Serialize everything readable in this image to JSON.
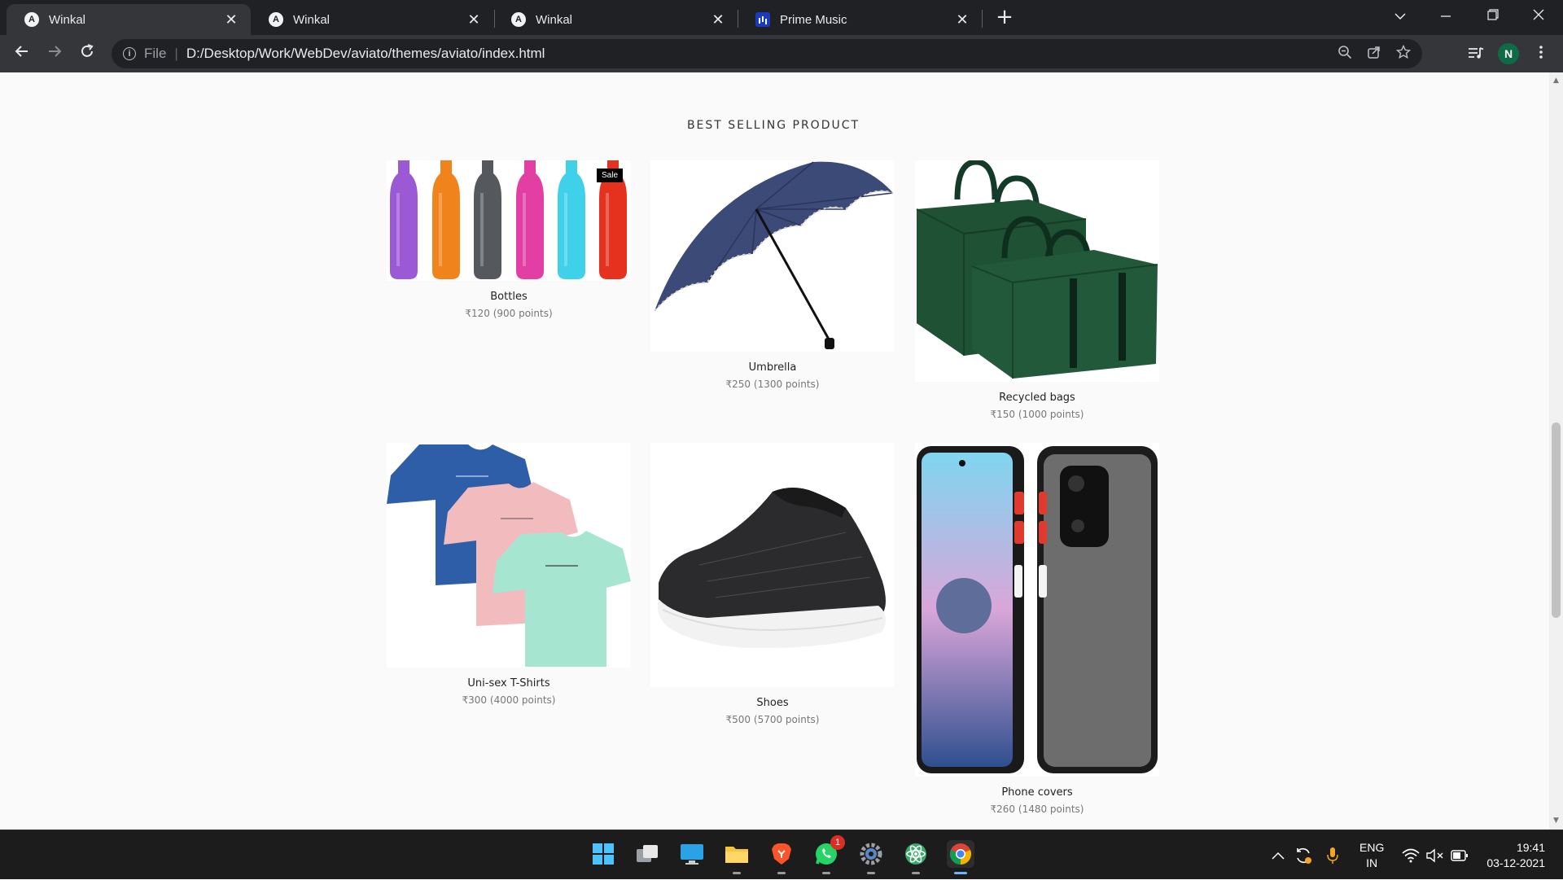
{
  "browser": {
    "tabs": [
      {
        "title": "Winkal",
        "favicon": "A",
        "active": true
      },
      {
        "title": "Winkal",
        "favicon": "A",
        "active": false
      },
      {
        "title": "Winkal",
        "favicon": "A",
        "active": false
      },
      {
        "title": "Prime Music",
        "favicon": "",
        "active": false
      }
    ],
    "address": {
      "scheme_label": "File",
      "url": "D:/Desktop/Work/WebDev/aviato/themes/aviato/index.html"
    },
    "profile_initial": "N"
  },
  "page": {
    "section_title": "BEST SELLING PRODUCT",
    "products": [
      {
        "name": "Bottles",
        "price": "₹120 (900 points)",
        "badge": "Sale"
      },
      {
        "name": "Umbrella",
        "price": "₹250 (1300 points)"
      },
      {
        "name": "Recycled bags",
        "price": "₹150 (1000 points)"
      },
      {
        "name": "Uni-sex T-Shirts",
        "price": "₹300 (4000 points)"
      },
      {
        "name": "Shoes",
        "price": "₹500 (5700 points)"
      },
      {
        "name": "Phone covers",
        "price": "₹260 (1480 points)"
      }
    ]
  },
  "taskbar": {
    "whatsapp_badge": "1",
    "language": {
      "line1": "ENG",
      "line2": "IN"
    },
    "clock": {
      "time": "19:41",
      "date": "03-12-2021"
    }
  },
  "colors": {
    "accent": "#0f6a46",
    "chrome_dark": "#202124",
    "chrome_mid": "#35363a"
  }
}
